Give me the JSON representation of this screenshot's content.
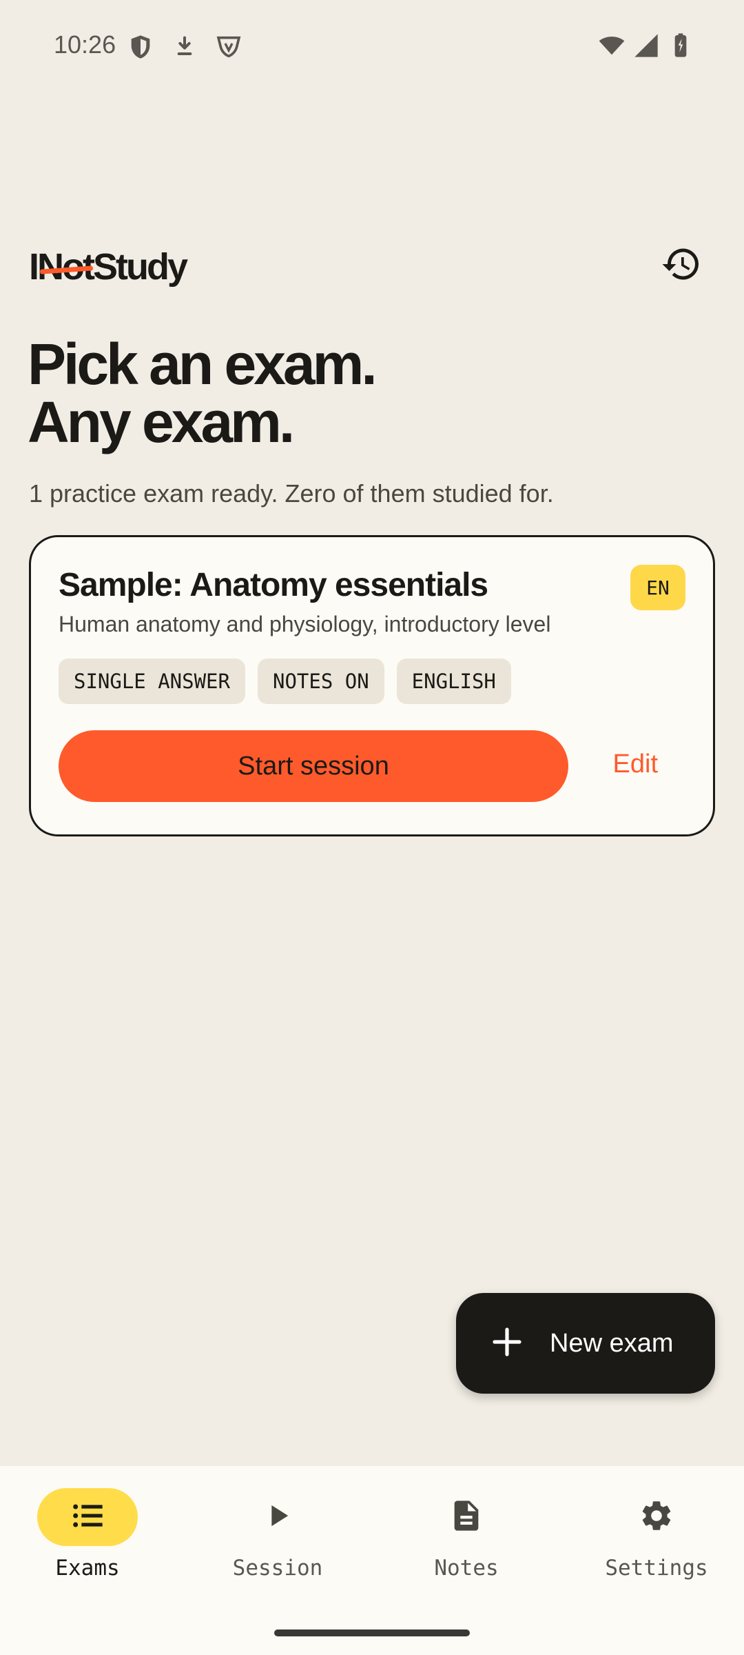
{
  "status_bar": {
    "time": "10:26",
    "left_icons": [
      "shield-icon",
      "download-icon",
      "vpn-shield-icon"
    ],
    "right_icons": [
      "wifi-icon",
      "signal-icon",
      "battery-charging-icon"
    ]
  },
  "header": {
    "logo_prefix": "I",
    "logo_struck": "Not",
    "logo_suffix": "Study",
    "history_icon": "history-icon"
  },
  "hero": {
    "title_line1": "Pick an exam.",
    "title_line2": "Any exam.",
    "subtitle": "1 practice exam ready. Zero of them studied for."
  },
  "exam_card": {
    "title": "Sample: Anatomy essentials",
    "description": "Human anatomy and physiology, introductory level",
    "language_badge": "EN",
    "tags": [
      "SINGLE ANSWER",
      "NOTES ON",
      "ENGLISH"
    ],
    "start_label": "Start session",
    "edit_label": "Edit"
  },
  "fab": {
    "icon": "plus-icon",
    "label": "New exam"
  },
  "bottom_nav": {
    "items": [
      {
        "label": "Exams",
        "icon": "list-icon",
        "active": true
      },
      {
        "label": "Session",
        "icon": "play-icon",
        "active": false
      },
      {
        "label": "Notes",
        "icon": "document-icon",
        "active": false
      },
      {
        "label": "Settings",
        "icon": "gear-icon",
        "active": false
      }
    ]
  },
  "colors": {
    "background": "#f1ede4",
    "card": "#fdfbf6",
    "accent": "#ff5a2b",
    "highlight": "#ffd84a",
    "ink": "#1b1a17"
  }
}
